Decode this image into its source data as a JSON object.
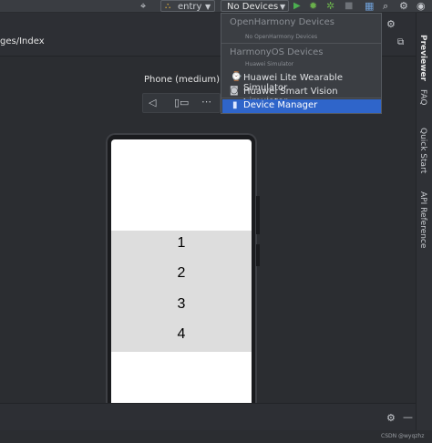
{
  "toolbar": {
    "entry_label": "entry",
    "devices_label": "No Devices",
    "icons": [
      "target-icon",
      "module-icon",
      "chevron-down-icon",
      "run-icon",
      "debug-icon",
      "profile-icon",
      "stop-icon",
      "device-manager-icon",
      "search-icon",
      "settings-icon",
      "avatar-icon"
    ]
  },
  "editor": {
    "path_label": "ges/Index"
  },
  "preview": {
    "device_label": "Phone (medium)",
    "numbers": [
      "1",
      "2",
      "3",
      "4"
    ]
  },
  "dropdown": {
    "group1_title": "OpenHarmony Devices",
    "group1_empty": "No OpenHarmony Devices",
    "group2_title": "HarmonyOS Devices",
    "group2_sub": "Huawei Simulator",
    "item_wearable": "Huawei Lite Wearable Simulator",
    "item_vision": "Huawei Smart Vision Simulator",
    "item_manager": "Device Manager"
  },
  "right_tabs": {
    "previewer": "Previewer",
    "faq": "FAQ",
    "quick_start": "Quick Start",
    "api_reference": "API Reference"
  },
  "watermark": "CSDN @wyqzhz",
  "colors": {
    "accent": "#2f65ca",
    "run_green": "#4caf50",
    "debug_green": "#6ab04c"
  }
}
